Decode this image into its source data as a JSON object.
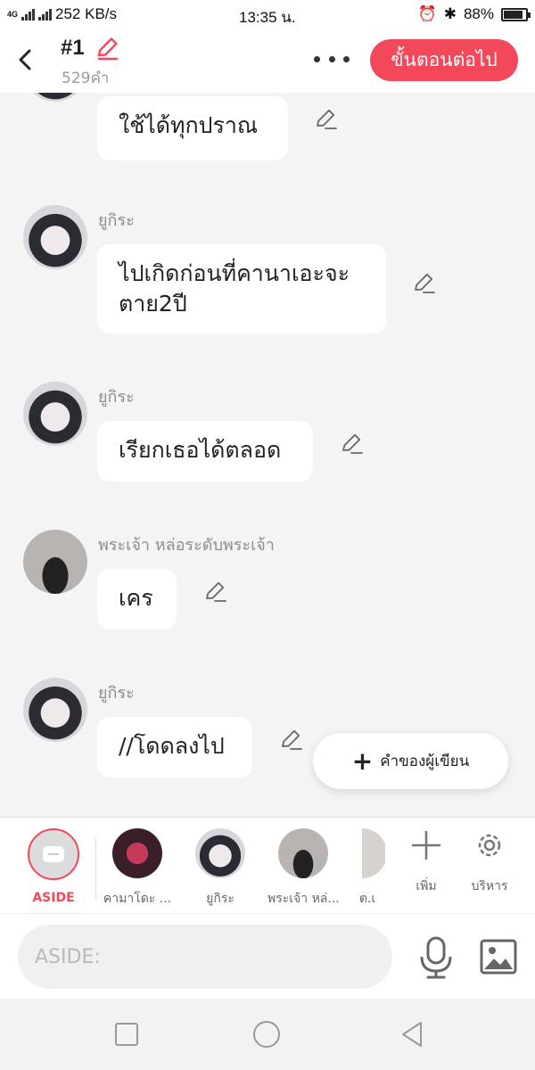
{
  "status_bar": {
    "network_type": "4G",
    "speed": "252 KB/s",
    "time": "13:35 น.",
    "battery_percent": "88%",
    "battery_level": 0.88
  },
  "header": {
    "title": "#1",
    "word_count": "529คำ",
    "next_button": "ขั้นตอนต่อไป"
  },
  "messages": [
    {
      "sender": "",
      "text": "ใช้ได้ทุกปราณ",
      "avatar": "girl-avatar"
    },
    {
      "sender": "ยูกิระ",
      "text": "ไปเกิดก่อนที่คานาเอะจะตาย2ปี",
      "avatar": "girl-avatar"
    },
    {
      "sender": "ยูกิระ",
      "text": "เรียกเธอได้ตลอด",
      "avatar": "girl-avatar"
    },
    {
      "sender": "พระเจ้า หล่อระดับพระเจ้า",
      "text": "เคร",
      "avatar": "mask-avatar"
    },
    {
      "sender": "ยูกิระ",
      "text": "//โดดลงไป",
      "avatar": "girl-avatar"
    }
  ],
  "writer_button": "คำของผู้เขียน",
  "characters": {
    "aside": "ASIDE",
    "items": [
      "คามาโดะ ...",
      "ยูกิระ",
      "พระเจ้า หล่...",
      "ต.เ"
    ],
    "add_label": "เพิ่ม",
    "manage_label": "บริหาร"
  },
  "input": {
    "placeholder": "ASIDE:"
  },
  "colors": {
    "accent": "#f2485a",
    "background": "#f4f4f4"
  }
}
